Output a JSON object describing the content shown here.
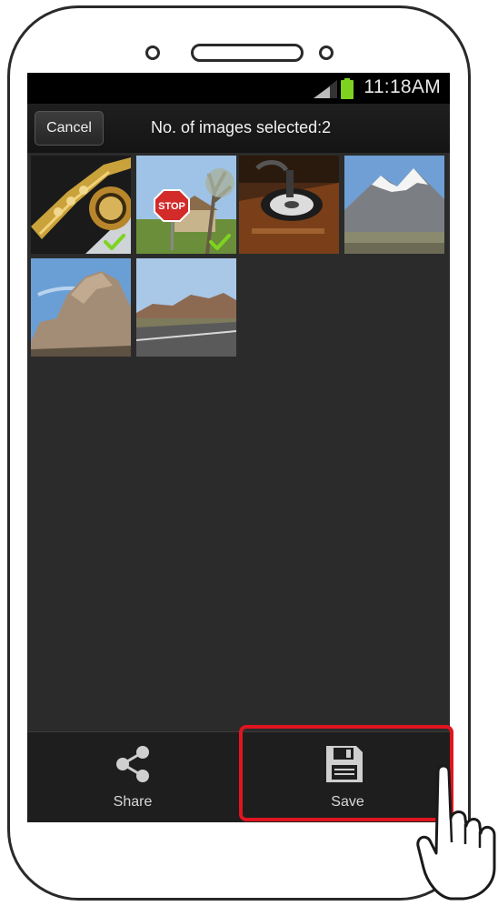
{
  "status_bar": {
    "time": "11:18AM",
    "icons": [
      "signal-icon",
      "battery-icon"
    ]
  },
  "action_bar": {
    "cancel_label": "Cancel",
    "title": "No. of images selected:2"
  },
  "gallery": {
    "images": [
      {
        "subject": "saxophone",
        "selected": true
      },
      {
        "subject": "stop-sign",
        "selected": true
      },
      {
        "subject": "record-player",
        "selected": false
      },
      {
        "subject": "snowy-mountain",
        "selected": false
      },
      {
        "subject": "rock-formation",
        "selected": false
      },
      {
        "subject": "desert-road",
        "selected": false
      }
    ],
    "stop_sign_text": "STOP"
  },
  "bottom_bar": {
    "share_label": "Share",
    "save_label": "Save",
    "icons": [
      "share-icon",
      "save-icon"
    ]
  },
  "colors": {
    "highlight": "#e0151f",
    "check": "#7ed321",
    "background": "#2b2b2b"
  }
}
